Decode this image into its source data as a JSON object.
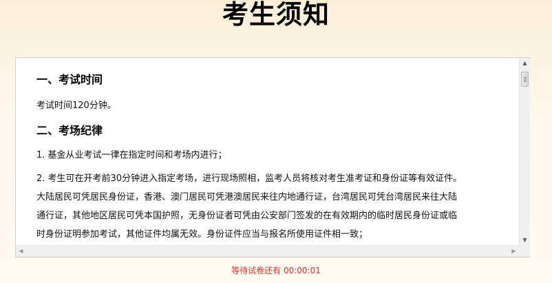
{
  "page": {
    "title": "考生须知"
  },
  "notice": {
    "section1_heading": "一、考试时间",
    "section1_text": "考试时间120分钟。",
    "section2_heading": "二、考场纪律",
    "rule1": "1. 基金从业考试一律在指定时间和考场内进行；",
    "rule2_line1": "2. 考生可在开考前30分钟进入指定考场，进行现场照相，监考人员将核对考生准考证和身份证等有效证件。",
    "rule2_line2": "大陆居民可凭居民身份证，香港、澳门居民可凭港澳居民来往内地通行证，台湾居民可凭台湾居民来往大陆",
    "rule2_line3": "通行证，其他地区居民可凭本国护照，无身份证者可凭由公安部门签发的在有效期内的临时居民身份证或临",
    "rule2_line4": "时身份证明参加考试，其他证件均属无效。身份证件应当与报名所使用证件相一致；"
  },
  "scrollbar": {
    "up_icon": "arrow-up-icon",
    "down_icon": "arrow-down-icon",
    "left_icon": "arrow-left-icon",
    "right_icon": "arrow-right-icon"
  },
  "status": {
    "countdown_text": "等待试卷还有 00:00:01"
  },
  "colors": {
    "countdown": "#d9302b",
    "background_top": "#fbeed6",
    "background_bottom": "#fffaf2"
  }
}
